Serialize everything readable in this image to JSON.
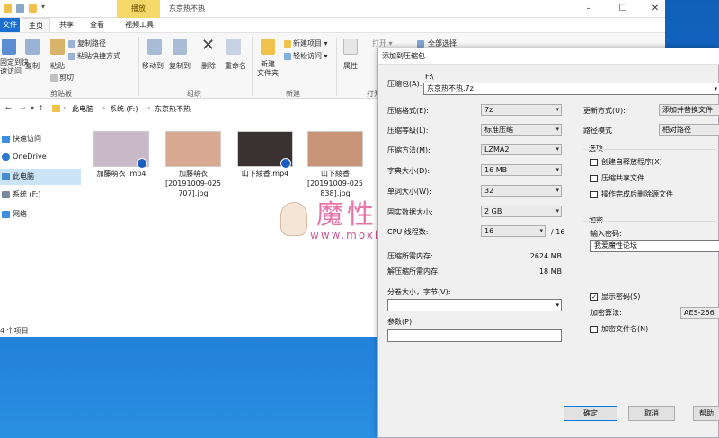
{
  "explorer": {
    "ctx_tab": "播放",
    "window_title": "东京热不热",
    "tabs": [
      "文件",
      "主页",
      "共享",
      "查看",
      "视频工具"
    ],
    "ribbon": {
      "pin_label": "固定到快\n速访问",
      "copy_label": "复制",
      "paste_label": "粘贴",
      "copy_path": "复制路径",
      "paste_shortcut": "粘贴快捷方式",
      "cut": "剪切",
      "clipboard_group": "剪贴板",
      "move_to": "移动到",
      "copy_to": "复制到",
      "delete": "删除",
      "rename": "重命名",
      "organize_group": "组织",
      "new_folder": "新建\n文件夹",
      "new_item": "新建项目 ▾",
      "easy_access": "轻松访问 ▾",
      "new_group": "新建",
      "properties": "属性",
      "open": "打开 ▾",
      "select_all": "全部选择",
      "open_group": "打开"
    },
    "address": {
      "crumbs": [
        "此电脑",
        "系统 (F:)",
        "东京热不热"
      ]
    },
    "nav": [
      "快速访问",
      "OneDrive",
      "此电脑",
      "系统 (F:)",
      "网络"
    ],
    "files": [
      {
        "name": "加藤萌衣 .mp4",
        "thumb": "#c8b8c8"
      },
      {
        "name": "加藤萌衣\n[20191009-025\n707].jpg",
        "thumb": "#d8a890"
      },
      {
        "name": "山下綾香.mp4",
        "thumb": "#3a3230"
      },
      {
        "name": "山下綾香\n[20191009-025\n838].jpg",
        "thumb": "#c89478"
      }
    ],
    "status": "4 个项目"
  },
  "watermark": {
    "text": "魔性论坛",
    "url": "www.moxing.cool"
  },
  "dialog": {
    "title": "添加到压缩包",
    "archive_label": "压缩包(A):",
    "archive_dir": "F:\\",
    "archive_name": "东京热不热.7z",
    "format_label": "压缩格式(E):",
    "format": "7z",
    "level_label": "压缩等级(L):",
    "level": "标准压缩",
    "method_label": "压缩方法(M):",
    "method": "LZMA2",
    "dict_label": "字典大小(D):",
    "dict": "16 MB",
    "word_label": "单词大小(W):",
    "word": "32",
    "solid_label": "固实数据大小:",
    "solid": "2 GB",
    "threads_label": "CPU 线程数:",
    "threads": "16",
    "threads_total": "/ 16",
    "mem_comp_label": "压缩所需内存:",
    "mem_comp": "2624 MB",
    "mem_decomp_label": "解压缩所需内存:",
    "mem_decomp": "18 MB",
    "split_label": "分卷大小，字节(V):",
    "params_label": "参数(P):",
    "update_label": "更新方式(U):",
    "update": "添加并替换文件",
    "path_label": "路径模式",
    "path": "相对路径",
    "options_label": "选项",
    "opt_sfx": "创建自释放程序(X)",
    "opt_shared": "压缩共享文件",
    "opt_delete": "操作完成后删除源文件",
    "enc_label": "加密",
    "pwd_label": "输入密码:",
    "pwd_value": "我爱魔性论坛",
    "show_pwd": "显示密码(S)",
    "enc_method_label": "加密算法:",
    "enc_method": "AES-256",
    "enc_names": "加密文件名(N)",
    "ok": "确定",
    "cancel": "取消",
    "help": "帮助"
  }
}
